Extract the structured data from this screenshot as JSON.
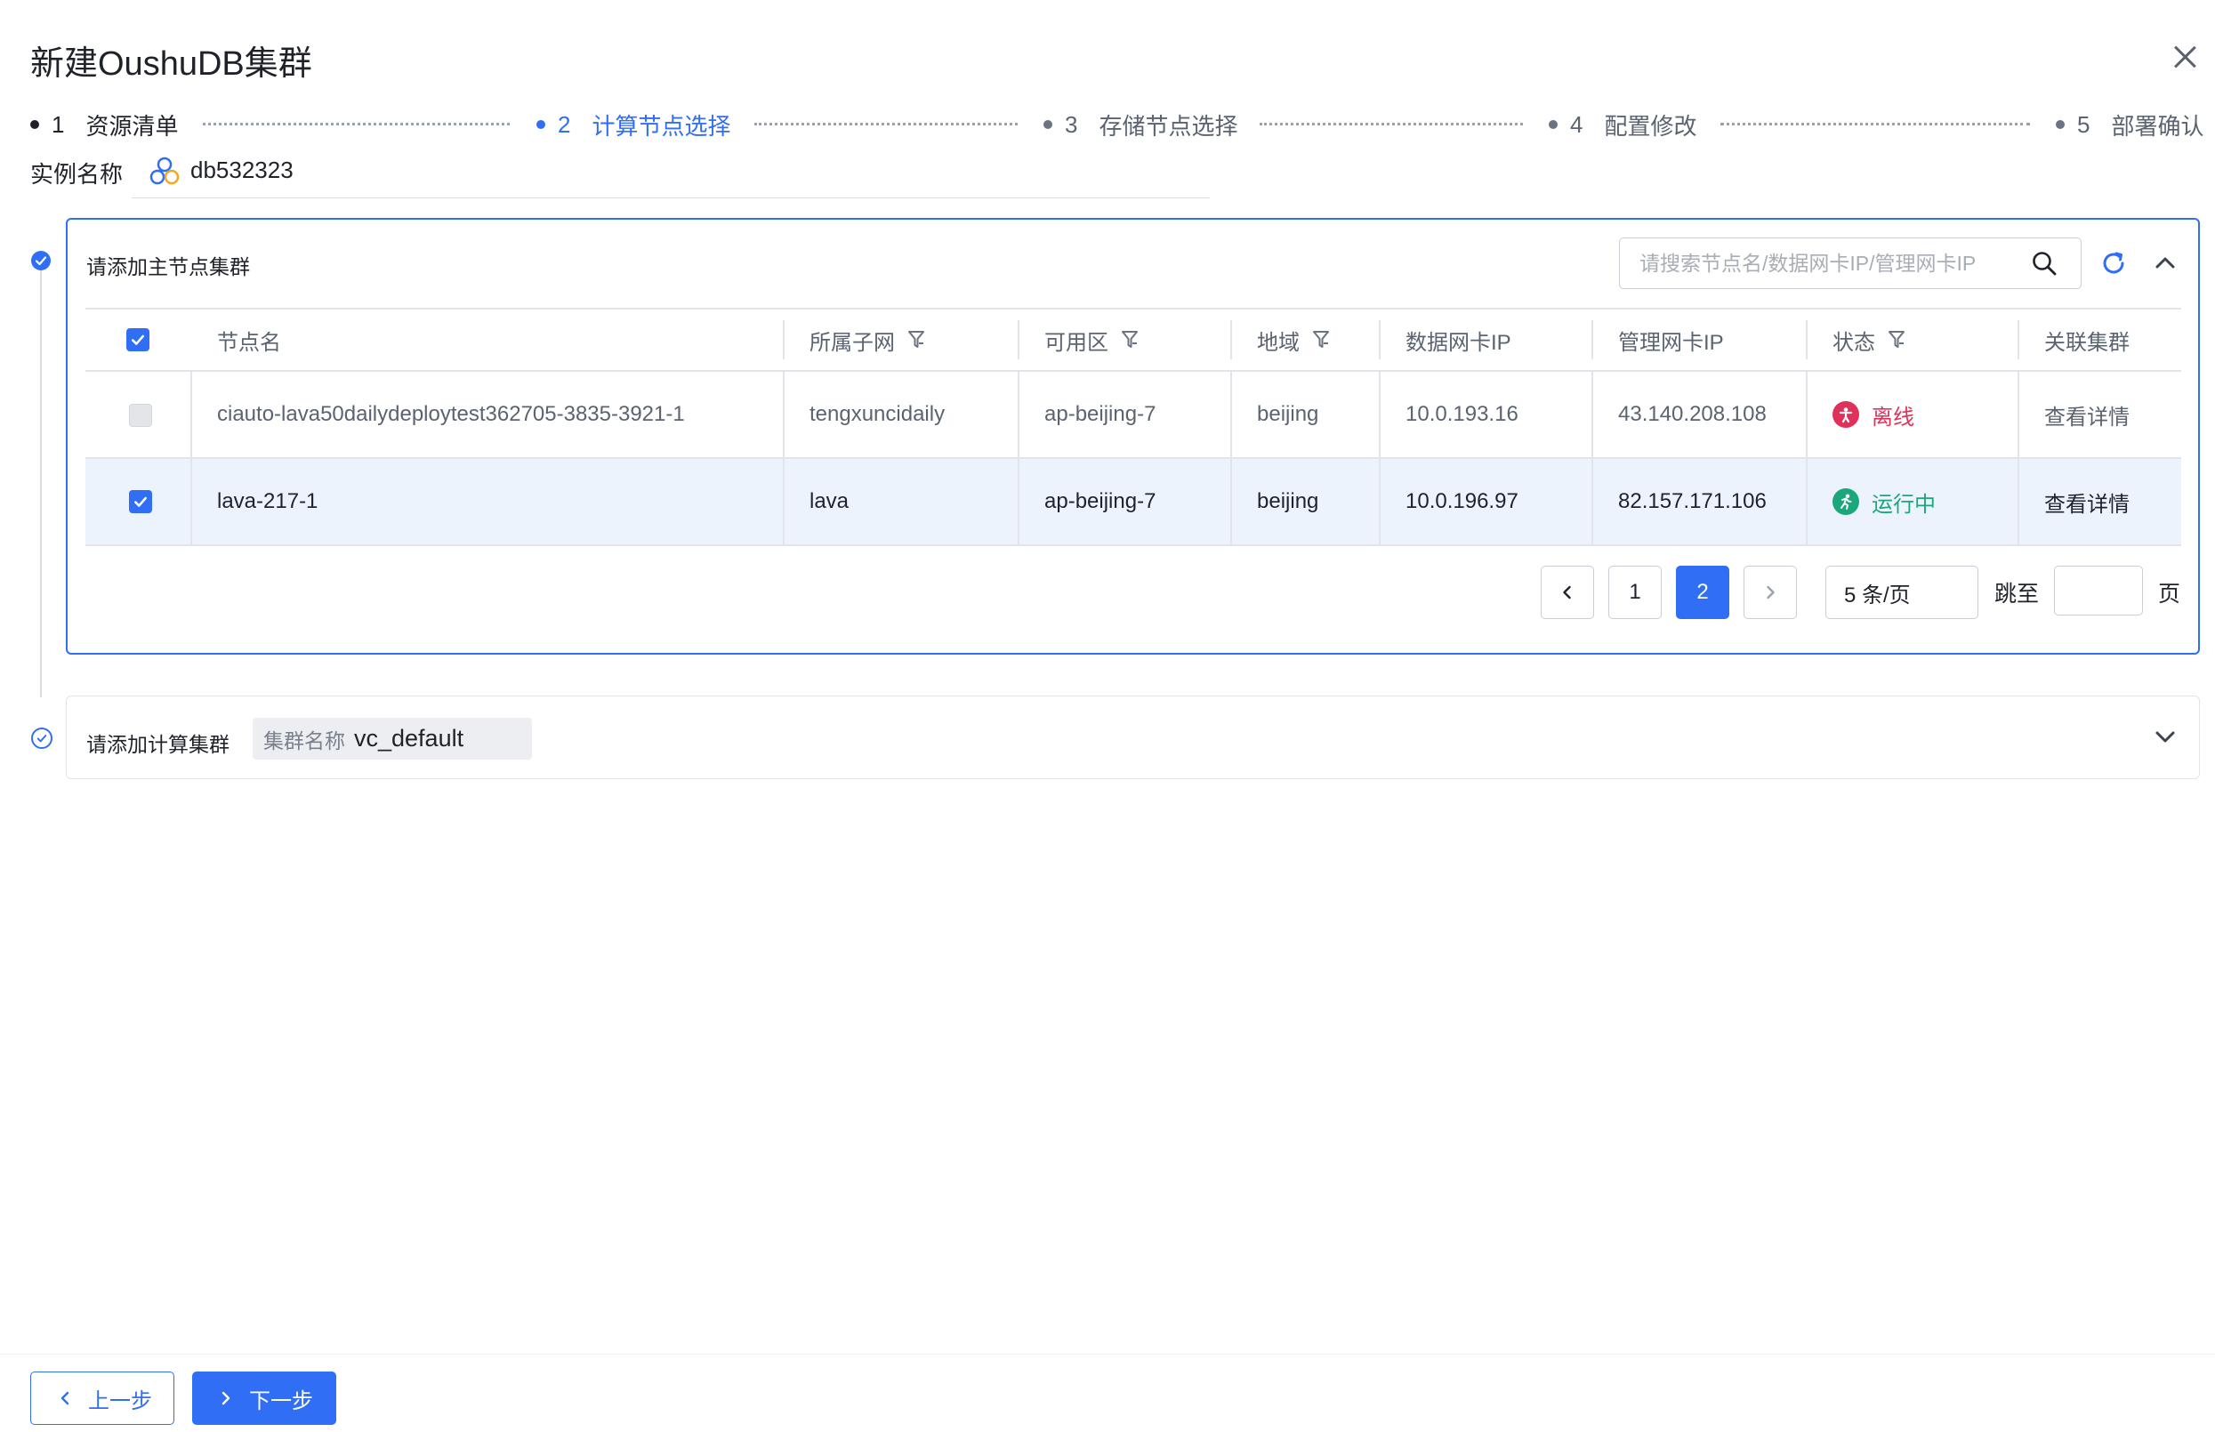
{
  "dialog": {
    "title": "新建OushuDB集群"
  },
  "steps": [
    {
      "num": "1",
      "label": "资源清单"
    },
    {
      "num": "2",
      "label": "计算节点选择"
    },
    {
      "num": "3",
      "label": "存储节点选择"
    },
    {
      "num": "4",
      "label": "配置修改"
    },
    {
      "num": "5",
      "label": "部署确认"
    }
  ],
  "instance": {
    "label": "实例名称",
    "value": "db532323"
  },
  "master_panel": {
    "title": "请添加主节点集群",
    "search_placeholder": "请搜索节点名/数据网卡IP/管理网卡IP",
    "columns": [
      "节点名",
      "所属子网",
      "可用区",
      "地域",
      "数据网卡IP",
      "管理网卡IP",
      "状态",
      "关联集群"
    ],
    "rows": [
      {
        "selected": false,
        "disabled": true,
        "name": "ciauto-lava50dailydeploytest362705-3835-3921-1",
        "subnet": "tengxuncidaily",
        "zone": "ap-beijing-7",
        "region": "beijing",
        "data_ip": "10.0.193.16",
        "mgmt_ip": "43.140.208.108",
        "status": "离线",
        "link": "查看详情"
      },
      {
        "selected": true,
        "disabled": false,
        "name": "lava-217-1",
        "subnet": "lava",
        "zone": "ap-beijing-7",
        "region": "beijing",
        "data_ip": "10.0.196.97",
        "mgmt_ip": "82.157.171.106",
        "status": "运行中",
        "link": "查看详情"
      }
    ],
    "pagination": {
      "pages": [
        "1",
        "2"
      ],
      "current": "2",
      "page_size": "5 条/页",
      "jump_label": "跳至",
      "page_suffix": "页"
    }
  },
  "compute_panel": {
    "title": "请添加计算集群",
    "cluster_name_label": "集群名称",
    "cluster_name_value": "vc_default"
  },
  "footer": {
    "prev_label": "上一步",
    "next_label": "下一步"
  },
  "colors": {
    "primary": "#2f6ef5",
    "offline": "#e0315a",
    "running": "#1aa87a"
  },
  "icons": [
    "close-icon",
    "search-icon",
    "refresh-icon",
    "chevron-up-icon",
    "chevron-down-icon",
    "filter-icon",
    "cluster-logo-icon",
    "offline-status-icon",
    "running-status-icon",
    "check-icon"
  ]
}
